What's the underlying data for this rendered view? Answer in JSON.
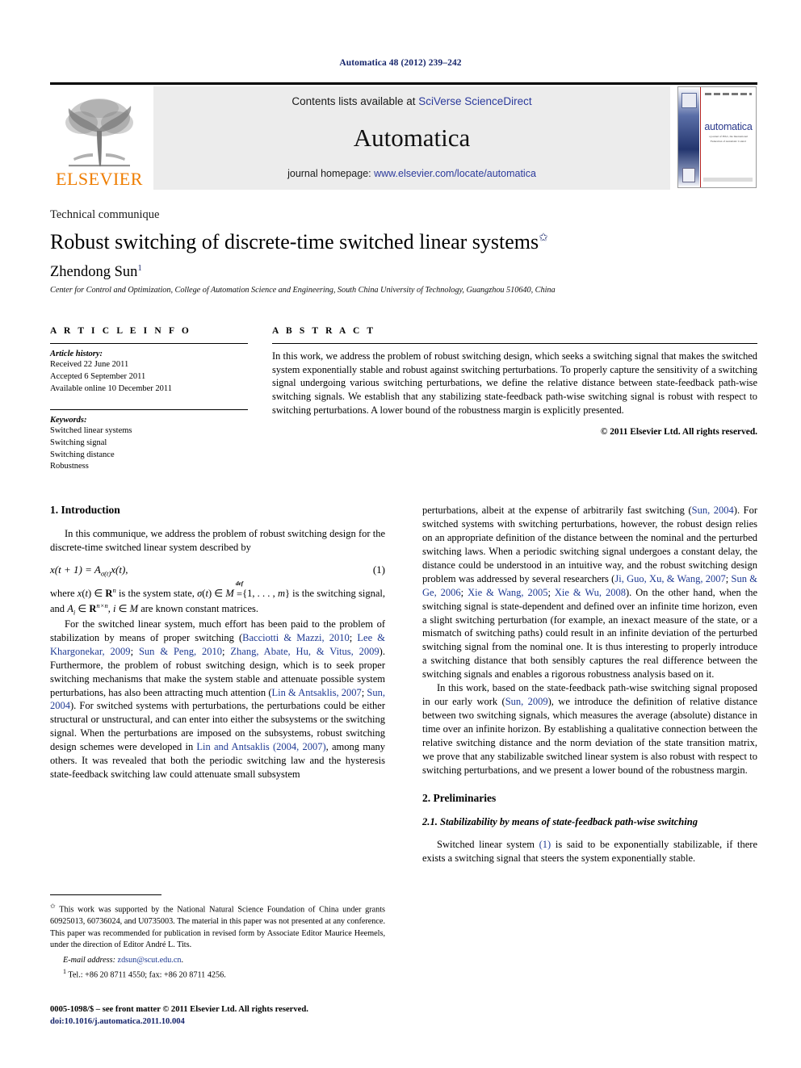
{
  "running_head": "Automatica 48 (2012) 239–242",
  "masthead": {
    "publisher_name": "ELSEVIER",
    "contents_prefix": "Contents lists available at ",
    "contents_link": "SciVerse ScienceDirect",
    "journal_name": "Automatica",
    "homepage_prefix": "journal homepage: ",
    "homepage_link": "www.elsevier.com/locate/automatica",
    "cover": {
      "title": "automatica",
      "subtitle": "a journal of IFAC, the International Federation of Automatic Control"
    }
  },
  "article": {
    "type": "Technical communique",
    "title": "Robust switching of discrete-time switched linear systems",
    "title_footnote_marker": "✩",
    "author": "Zhendong Sun",
    "author_footnote_marker": "1",
    "affiliation": "Center for Control and Optimization, College of Automation Science and Engineering, South China University of Technology, Guangzhou 510640, China"
  },
  "info": {
    "heading": "A R T I C L E   I N F O",
    "history_label": "Article history:",
    "history": [
      "Received 22 June 2011",
      "Accepted 6 September 2011",
      "Available online 10 December 2011"
    ],
    "keywords_label": "Keywords:",
    "keywords": [
      "Switched linear systems",
      "Switching signal",
      "Switching distance",
      "Robustness"
    ]
  },
  "abstract": {
    "heading": "A B S T R A C T",
    "text": "In this work, we address the problem of robust switching design, which seeks a switching signal that makes the switched system exponentially stable and robust against switching perturbations. To properly capture the sensitivity of a switching signal undergoing various switching perturbations, we define the relative distance between state-feedback path-wise switching signals. We establish that any stabilizing state-feedback path-wise switching signal is robust with respect to switching perturbations. A lower bound of the robustness margin is explicitly presented.",
    "copyright": "© 2011 Elsevier Ltd. All rights reserved."
  },
  "sections": {
    "introduction_heading": "1. Introduction",
    "intro_p1_a": "In this communique, we address the problem of robust switching design for the discrete-time switched linear system described by",
    "equation_1_number": "(1)",
    "intro_p2_after_eq": "are known constant matrices.",
    "intro_p3": "For the switched linear system, much effort has been paid to the problem of stabilization by means of proper switching (",
    "intro_p3_cite1": "Bacciotti & Mazzi, 2010",
    "intro_p3_cite2": "Lee & Khargonekar, 2009",
    "intro_p3_cite3": "Sun & Peng, 2010",
    "intro_p3_cite4": "Zhang, Abate, Hu, & Vitus, 2009",
    "intro_p3_b": "). Furthermore, the problem of robust switching design, which is to seek proper switching mechanisms that make the system stable and attenuate possible system perturbations, has also been attracting much attention (",
    "intro_p3_cite5": "Lin & Antsaklis, 2007",
    "intro_p3_cite6": "Sun, 2004",
    "intro_p3_c": "). For switched systems with perturbations, the perturbations could be either structural or unstructural, and can enter into either the subsystems or the switching signal. When the perturbations are imposed on the subsystems, robust switching design schemes were developed in ",
    "intro_p3_cite7": "Lin and Antsaklis (2004, 2007)",
    "intro_p3_d": ", among many others. It was revealed that both the periodic switching law and the hysteresis state-feedback switching law could attenuate small subsystem",
    "right_p1_a": "perturbations, albeit at the expense of arbitrarily fast switching (",
    "right_p1_cite1": "Sun, 2004",
    "right_p1_b": "). For switched systems with switching perturbations, however, the robust design relies on an appropriate definition of the distance between the nominal and the perturbed switching laws. When a periodic switching signal undergoes a constant delay, the distance could be understood in an intuitive way, and the robust switching design problem was addressed by several researchers (",
    "right_p1_cite2": "Ji, Guo, Xu, & Wang, 2007",
    "right_p1_cite3": "Sun & Ge, 2006",
    "right_p1_cite4": "Xie & Wang, 2005",
    "right_p1_cite5": "Xie & Wu, 2008",
    "right_p1_c": "). On the other hand, when the switching signal is state-dependent and defined over an infinite time horizon, even a slight switching perturbation (for example, an inexact measure of the state, or a mismatch of switching paths) could result in an infinite deviation of the perturbed switching signal from the nominal one. It is thus interesting to properly introduce a switching distance that both sensibly captures the real difference between the switching signals and enables a rigorous robustness analysis based on it.",
    "right_p2_a": "In this work, based on the state-feedback path-wise switching signal proposed in our early work (",
    "right_p2_cite1": "Sun, 2009",
    "right_p2_b": "), we introduce the definition of relative distance between two switching signals, which measures the average (absolute) distance in time over an infinite horizon. By establishing a qualitative connection between the relative switching distance and the norm deviation of the state transition matrix, we prove that any stabilizable switched linear system is also robust with respect to switching perturbations, and we present a lower bound of the robustness margin.",
    "preliminaries_heading": "2. Preliminaries",
    "subsection_2_1": "2.1. Stabilizability by means of state-feedback path-wise switching",
    "prelim_p1_a": "Switched linear system ",
    "prelim_p1_ref": "(1)",
    "prelim_p1_b": " is said to be exponentially stabilizable, if there exists a switching signal that steers the system exponentially stable."
  },
  "footnotes": {
    "star_marker": "✩",
    "star_text": "This work was supported by the National Natural Science Foundation of China under grants 60925013, 60736024, and U0735003. The material in this paper was not presented at any conference. This paper was recommended for publication in revised form by Associate Editor Maurice Heemels, under the direction of Editor André L. Tits.",
    "email_label": "E-mail address:",
    "email": "zdsun@scut.edu.cn",
    "email_suffix": ".",
    "tel_marker": "1",
    "tel_text": "Tel.: +86 20 8711 4550; fax: +86 20 8711 4256.",
    "imprint_line1": "0005-1098/$ – see front matter © 2011 Elsevier Ltd. All rights reserved.",
    "imprint_doi": "doi:10.1016/j.automatica.2011.10.004"
  },
  "colors": {
    "link": "#1f3a93",
    "elsevier_orange": "#ef7d00",
    "running_head": "#16256b",
    "band_gray": "#ececec"
  }
}
